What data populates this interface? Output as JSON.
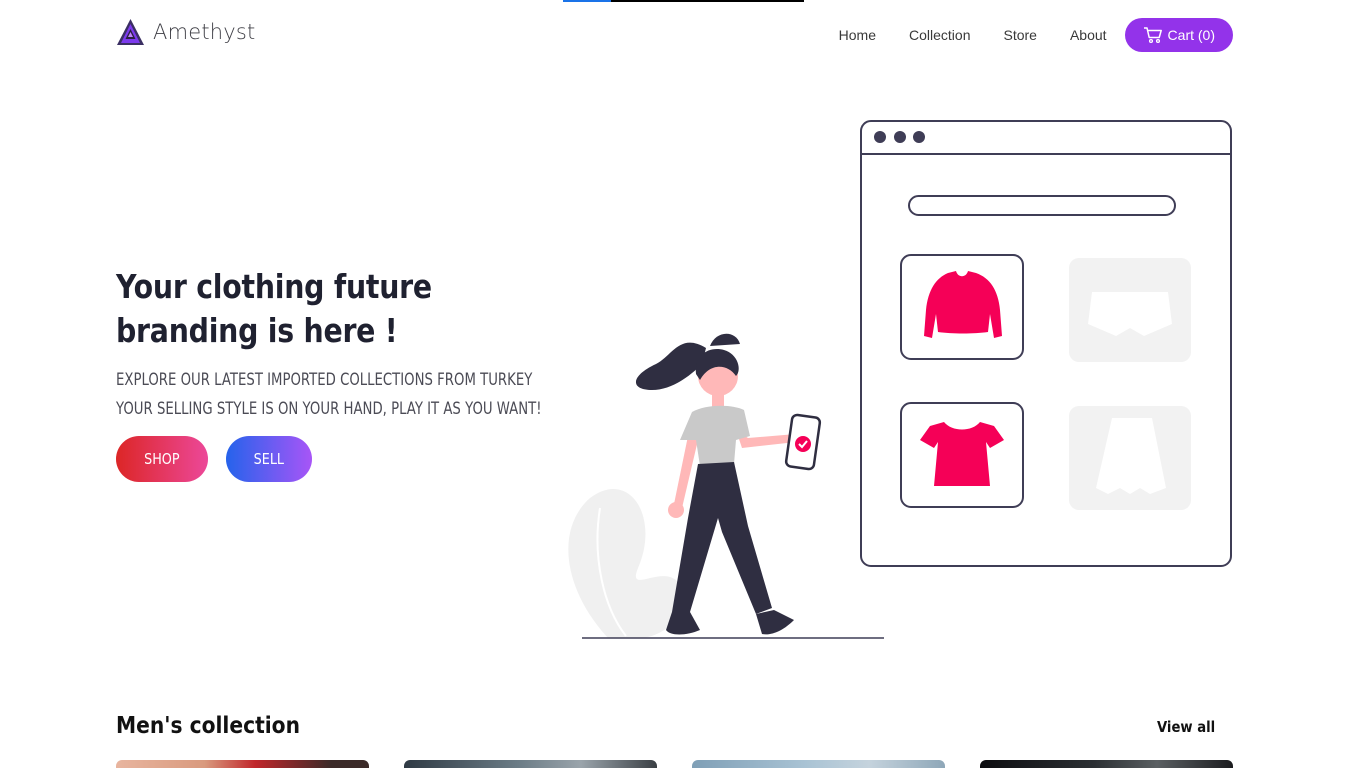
{
  "brand": {
    "name": "Amethyst",
    "logo_icon": "amethyst-triangle-logo"
  },
  "nav": {
    "links": [
      "Home",
      "Collection",
      "Store",
      "About"
    ],
    "cart_label": "Cart (0)",
    "cart_icon": "cart-icon"
  },
  "hero": {
    "title": "Your clothing future branding is here !",
    "subtitle_line1": "EXPLORE OUR LATEST IMPORTED COLLECTIONS FROM TURKEY",
    "subtitle_line2": "YOUR SELLING STYLE IS ON YOUR HAND, PLAY IT AS YOU WANT!",
    "shop_label": "SHOP",
    "sell_label": "SELL"
  },
  "collection": {
    "title": "Men's collection",
    "view_all": "View all",
    "card_count": 4
  },
  "colors": {
    "accent": "#9333ea",
    "shop_gradient": [
      "#dc2626",
      "#ec4899"
    ],
    "sell_gradient": [
      "#2563eb",
      "#a855f7"
    ],
    "product_pink": "#f50057",
    "ink": "#2f2e41"
  }
}
